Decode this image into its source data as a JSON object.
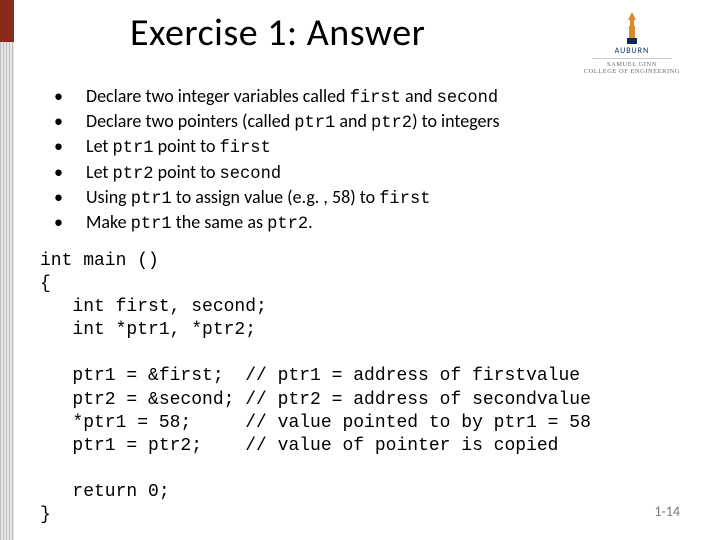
{
  "title": "Exercise 1: Answer",
  "logo": {
    "university": "AUBURN",
    "college_line1": "SAMUEL GINN",
    "college_line2": "COLLEGE OF ENGINEERING"
  },
  "bullets": [
    {
      "pre": "Declare two integer variables called ",
      "c1": "first",
      "mid": " and ",
      "c2": "second",
      "post": ""
    },
    {
      "pre": "Declare two pointers (called ",
      "c1": "ptr1",
      "mid": " and ",
      "c2": "ptr2",
      "post": ") to integers"
    },
    {
      "pre": "Let ",
      "c1": "ptr1",
      "mid": " point to ",
      "c2": "first",
      "post": ""
    },
    {
      "pre": "Let  ",
      "c1": "ptr2",
      "mid": " point to ",
      "c2": "second",
      "post": ""
    },
    {
      "pre": "Using ",
      "c1": "ptr1",
      "mid": " to assign value (e.g. , 58) to ",
      "c2": "first",
      "post": ""
    },
    {
      "pre": "Make ",
      "c1": "ptr1",
      "mid": " the same as ",
      "c2": "ptr2",
      "post": "."
    }
  ],
  "code": "int main ()\n{\n   int first, second;\n   int *ptr1, *ptr2;\n\n   ptr1 = &first;  // ptr1 = address of firstvalue\n   ptr2 = &second; // ptr2 = address of secondvalue\n   *ptr1 = 58;     // value pointed to by ptr1 = 58\n   ptr1 = ptr2;    // value of pointer is copied\n\n   return 0;\n}",
  "slide_number": "1-14"
}
